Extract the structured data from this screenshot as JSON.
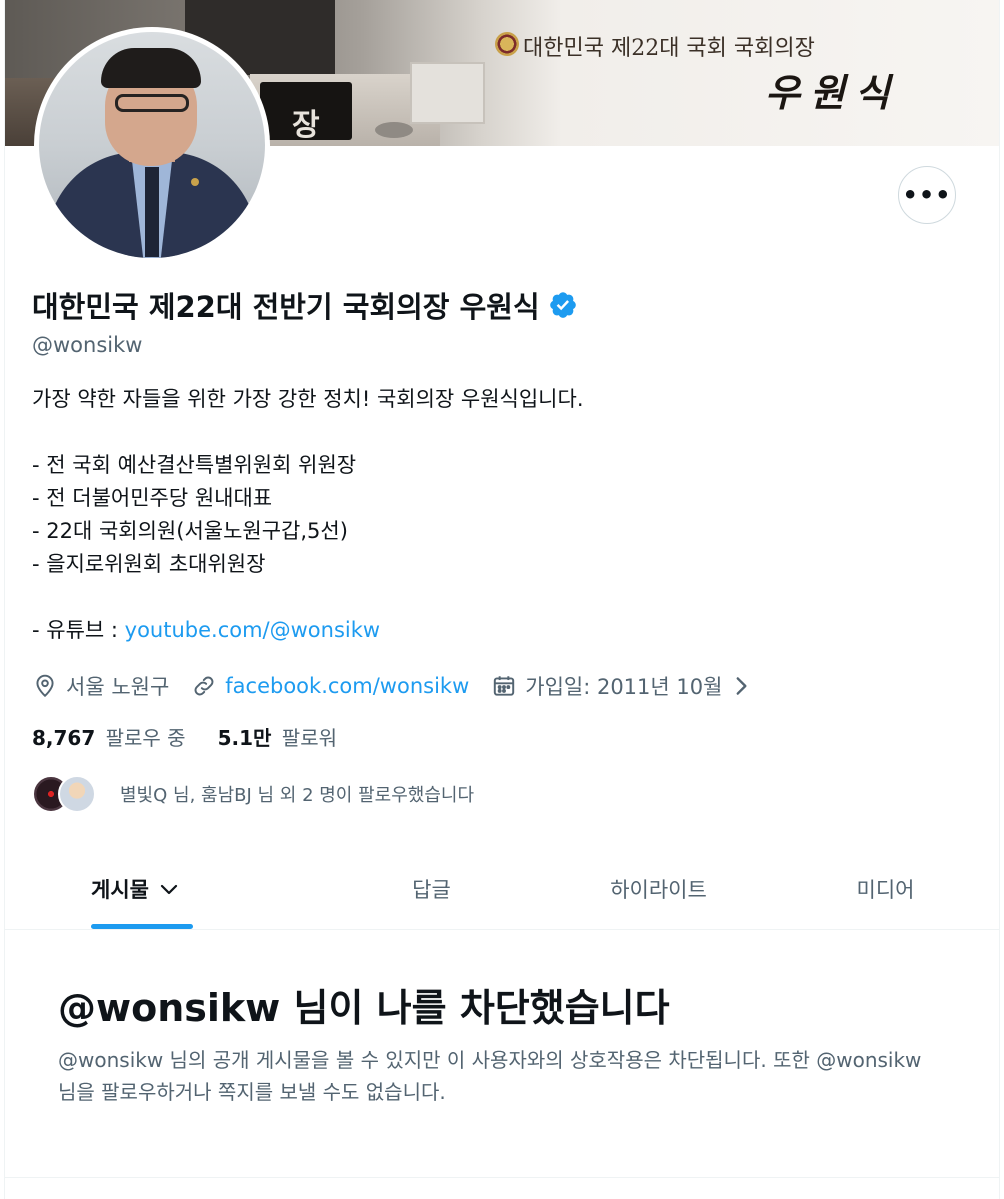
{
  "banner": {
    "title": "대한민국 제22대 국회 국회의장",
    "signature": "우원식",
    "plate_text": "장"
  },
  "profile": {
    "display_name": "대한민국 제22대 전반기 국회의장 우원식",
    "handle": "@wonsikw",
    "verified": true,
    "more_label": "•••"
  },
  "bio": {
    "intro": "가장 약한 자들을 위한 가장 강한 정치! 국회의장 우원식입니다.",
    "lines": [
      "- 전 국회 예산결산특별위원회 위원장",
      "- 전 더불어민주당 원내대표",
      "- 22대 국회의원(서울노원구갑,5선)",
      "- 을지로위원회 초대위원장"
    ],
    "youtube_prefix": "- 유튜브 : ",
    "youtube_link": "youtube.com/@wonsikw"
  },
  "meta": {
    "location": "서울 노원구",
    "website": "facebook.com/wonsikw",
    "joined": "가입일: 2011년 10월"
  },
  "stats": {
    "following_count": "8,767",
    "following_label": "팔로우 중",
    "followers_count": "5.1만",
    "followers_label": "팔로워"
  },
  "followed_by": {
    "text": "별빛Q 님, 훔남BJ 님 외 2 명이 팔로우했습니다"
  },
  "tabs": [
    {
      "label": "게시물",
      "active": true
    },
    {
      "label": "답글",
      "active": false
    },
    {
      "label": "하이라이트",
      "active": false
    },
    {
      "label": "미디어",
      "active": false
    }
  ],
  "blocked": {
    "title": "@wonsikw 님이 나를 차단했습니다",
    "description": "@wonsikw 님의 공개 게시물을 볼 수 있지만 이 사용자와의 상호작용은 차단됩니다. 또한 @wonsikw 님을 팔로우하거나 쪽지를 보낼 수도 없습니다."
  },
  "colors": {
    "accent": "#1d9bf0",
    "text_primary": "#0f1419",
    "text_secondary": "#536471",
    "border": "#eff3f4"
  },
  "icons": {
    "verified": "verified-badge-icon",
    "location": "location-pin-icon",
    "website": "link-icon",
    "joined": "calendar-icon",
    "more": "more-options-icon",
    "tab_dropdown": "chevron-down-icon",
    "joined_chevron": "chevron-right-icon"
  }
}
